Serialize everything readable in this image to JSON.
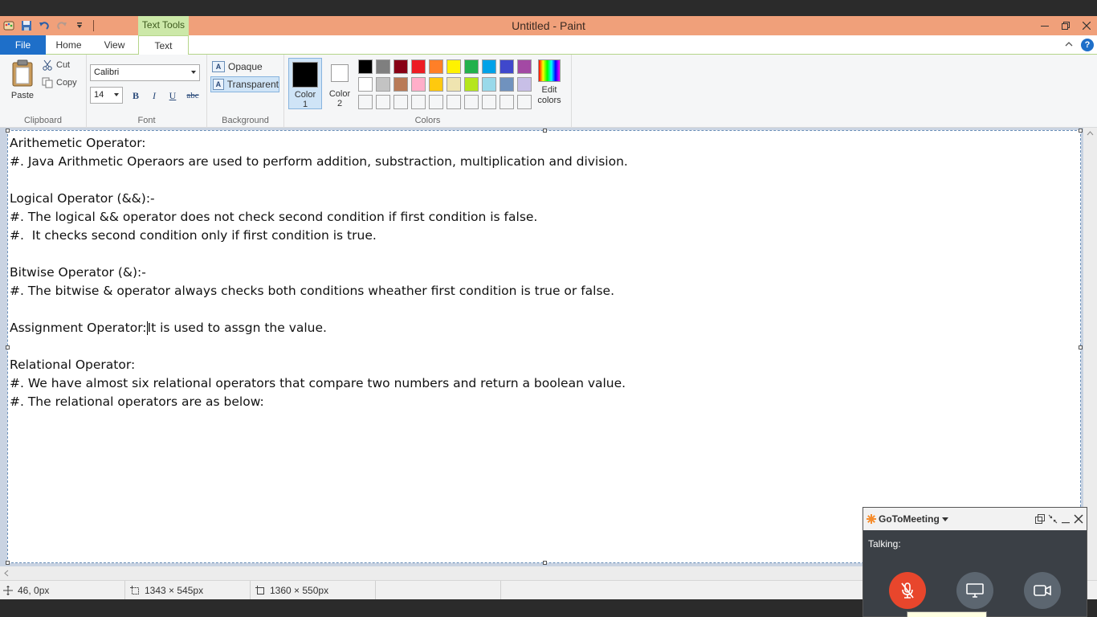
{
  "window": {
    "title": "Untitled - Paint",
    "context_tab": "Text Tools"
  },
  "tabs": {
    "file": "File",
    "home": "Home",
    "view": "View",
    "text": "Text"
  },
  "ribbon": {
    "clipboard": {
      "group_label": "Clipboard",
      "paste": "Paste",
      "cut": "Cut",
      "copy": "Copy"
    },
    "font": {
      "group_label": "Font",
      "family": "Calibri",
      "size": "14",
      "bold": "B",
      "italic": "I",
      "underline": "U",
      "strike": "abc"
    },
    "background": {
      "group_label": "Background",
      "opaque": "Opaque",
      "transparent": "Transparent",
      "selected": "transparent"
    },
    "colors": {
      "group_label": "Colors",
      "color1_label": "Color",
      "color1_num": "1",
      "color2_label": "Color",
      "color2_num": "2",
      "color1_value": "#000000",
      "color2_value": "#ffffff",
      "edit_label": "Edit",
      "edit_label2": "colors",
      "palette_row1": [
        "#000000",
        "#7f7f7f",
        "#880015",
        "#ed1c24",
        "#ff7f27",
        "#fff200",
        "#22b14c",
        "#00a2e8",
        "#3f48cc",
        "#a349a4"
      ],
      "palette_row2": [
        "#ffffff",
        "#c3c3c3",
        "#b97a57",
        "#ffaec9",
        "#ffc90e",
        "#efe4b0",
        "#b5e61d",
        "#99d9ea",
        "#7092be",
        "#c8bfe7"
      ],
      "palette_row3": [
        "#f5f6f7",
        "#f5f6f7",
        "#f5f6f7",
        "#f5f6f7",
        "#f5f6f7",
        "#f5f6f7",
        "#f5f6f7",
        "#f5f6f7",
        "#f5f6f7",
        "#f5f6f7"
      ]
    }
  },
  "canvas": {
    "lines": [
      "Arithemetic Operator:",
      "#. Java Arithmetic Operaors are used to perform addition, substraction, multiplication and division.",
      "",
      "Logical Operator (&&):-",
      "#. The logical && operator does not check second condition if first condition is false.",
      "#.  It checks second condition only if first condition is true.",
      "",
      "Bitwise Operator (&):-",
      "#. The bitwise & operator always checks both conditions wheather first condition is true or false.",
      "",
      "",
      "",
      "Relational Operator:",
      "#. We have almost six relational operators that compare two numbers and return a boolean value.",
      "#. The relational operators are as below:"
    ],
    "assignment_line_before": "Assignment Operator:",
    "assignment_line_after": "It is used to assgn the value."
  },
  "statusbar": {
    "cursor_pos": "46, 0px",
    "selection_size": "1343 × 545px",
    "image_size": "1360 × 550px"
  },
  "gotomeeting": {
    "brand": "GoToMeeting",
    "talking": "Talking:"
  }
}
